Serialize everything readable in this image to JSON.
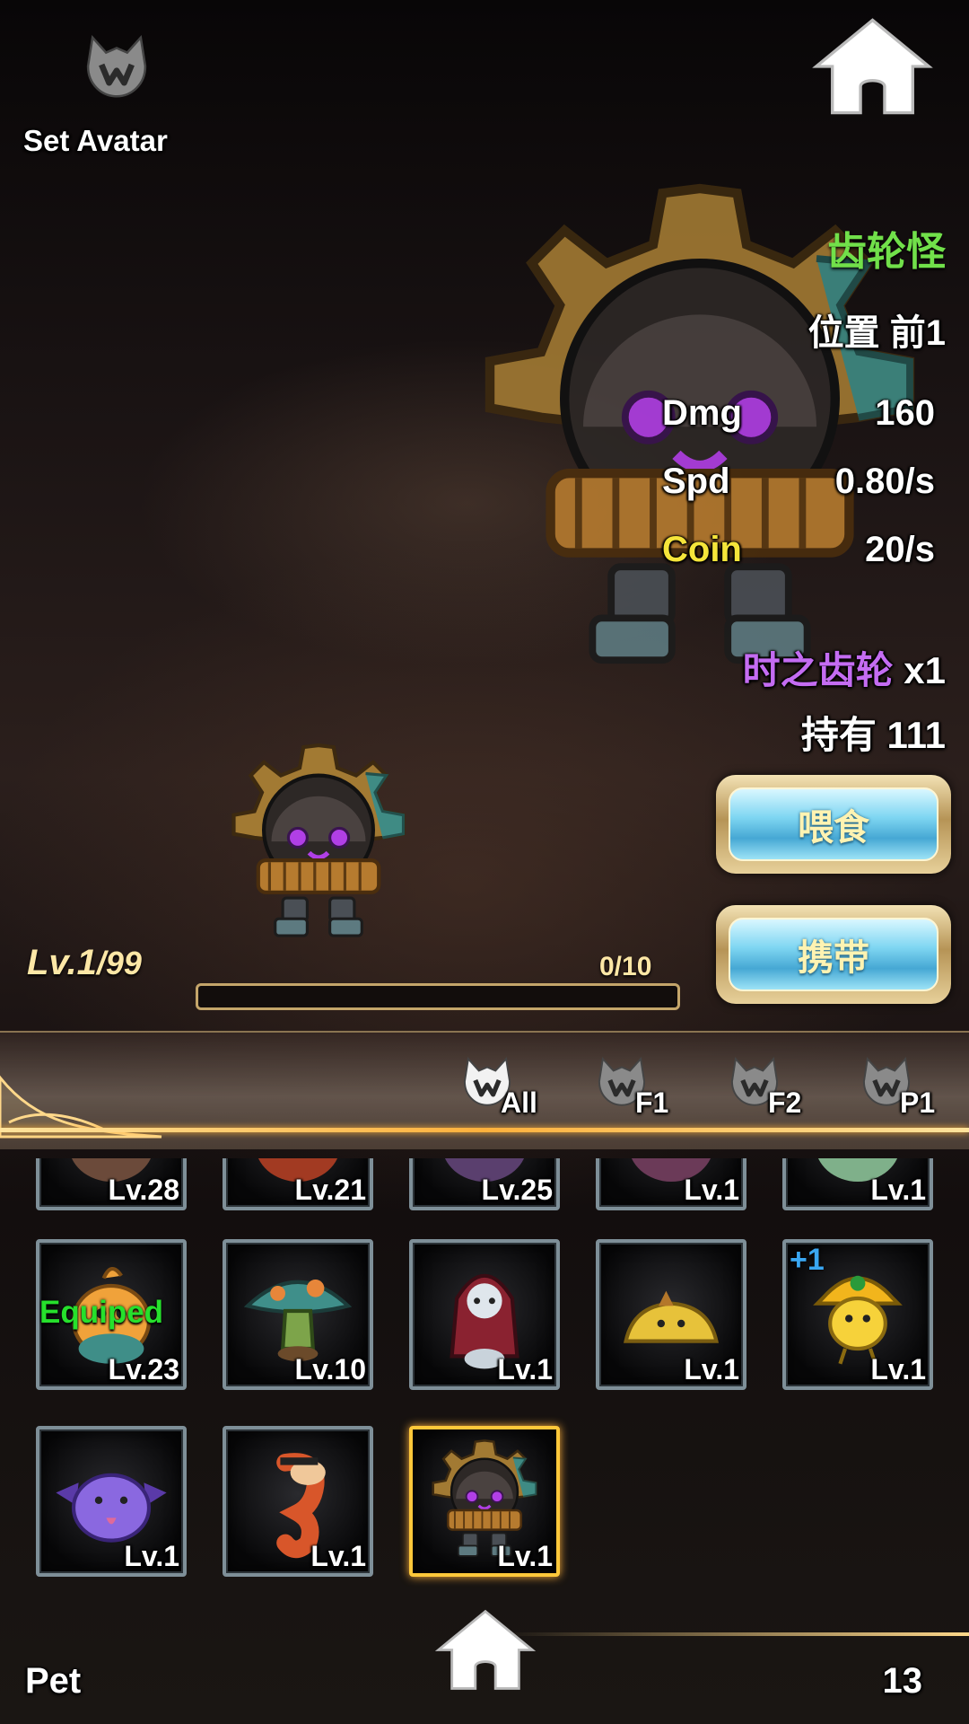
{
  "header": {
    "avatar_label": "Set Avatar",
    "avatar_icon": "wolf-emblem-icon",
    "home_icon": "home-icon"
  },
  "pet": {
    "name": "齿轮怪",
    "position_label": "位置",
    "position_value": "前1",
    "stats": [
      {
        "label": "Dmg",
        "value": "160"
      },
      {
        "label": "Spd",
        "value": "0.80/s"
      },
      {
        "label": "Coin",
        "value": "20/s"
      }
    ],
    "item_name": "时之齿轮",
    "item_qty": "x1",
    "own_label": "持有",
    "own_value": "111",
    "feed_label": "喂食",
    "carry_label": "携带",
    "level": "Lv.1",
    "level_max": "/99",
    "exp_text": "0/10",
    "exp_progress": 0
  },
  "filters": [
    {
      "label": "All",
      "active": true
    },
    {
      "label": "F1",
      "active": false
    },
    {
      "label": "F2",
      "active": false
    },
    {
      "label": "P1",
      "active": false
    }
  ],
  "grid": {
    "row_partial": [
      {
        "level": "Lv.28",
        "pet": "pet-partial-1"
      },
      {
        "level": "Lv.21",
        "pet": "pet-partial-2"
      },
      {
        "level": "Lv.25",
        "pet": "pet-partial-3"
      },
      {
        "level": "Lv.1",
        "pet": "pet-partial-4"
      },
      {
        "level": "Lv.1",
        "pet": "pet-partial-5"
      }
    ],
    "row_two": [
      {
        "level": "Lv.23",
        "pet": "orange-bird-pet",
        "equipped": "Equiped"
      },
      {
        "level": "Lv.10",
        "pet": "mushroom-pet"
      },
      {
        "level": "Lv.1",
        "pet": "red-hood-pet"
      },
      {
        "level": "Lv.1",
        "pet": "yellow-slime-pet"
      },
      {
        "level": "Lv.1",
        "pet": "hardhat-chick-pet",
        "badge": "+1"
      }
    ],
    "row_three": [
      {
        "level": "Lv.1",
        "pet": "purple-bat-slime-pet"
      },
      {
        "level": "Lv.1",
        "pet": "orange-seahorse-pet"
      },
      {
        "level": "Lv.1",
        "pet": "gear-monster-pet",
        "selected": true
      }
    ]
  },
  "footer": {
    "title": "Pet",
    "count": "13",
    "home_icon": "home-icon"
  },
  "colors": {
    "name_green": "#71e04a",
    "coin_yellow": "#f5e53a",
    "item_purple": "#c46cf2",
    "equipped_green": "#26e02c",
    "select_gold": "#ffc83a"
  }
}
